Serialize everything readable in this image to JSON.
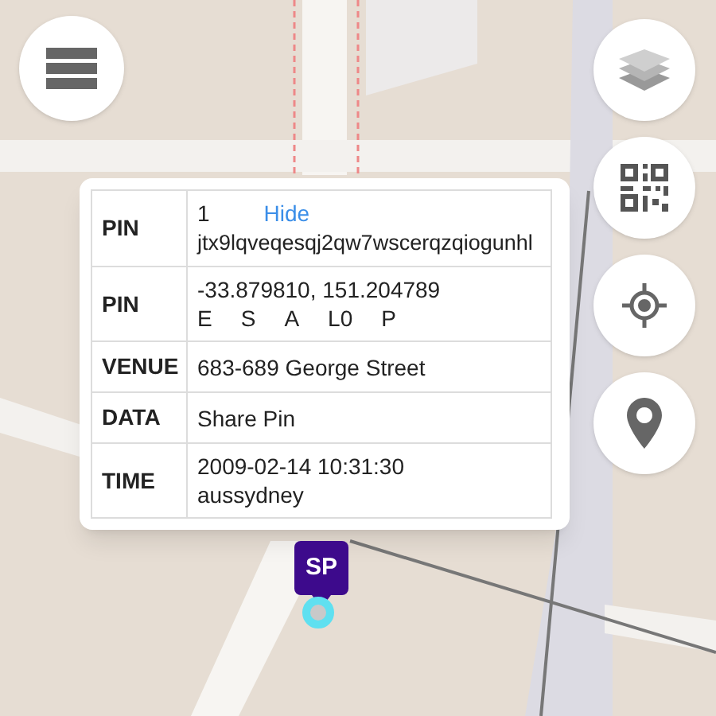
{
  "popup": {
    "rows": [
      {
        "kind": "pin_code",
        "label": "PIN",
        "number": "1",
        "link": "Hide",
        "code": "jtx9lqveqesqj2qw7wscerqzqiogunhl"
      },
      {
        "kind": "coords",
        "label": "PIN",
        "coords": "-33.879810, 151.204789",
        "flags": [
          "E",
          "S",
          "A",
          "L0",
          "P"
        ]
      },
      {
        "kind": "text",
        "label": "VENUE",
        "lines": [
          "683-689 George Street"
        ]
      },
      {
        "kind": "text",
        "label": "DATA",
        "lines": [
          "Share Pin"
        ]
      },
      {
        "kind": "text",
        "label": "TIME",
        "lines": [
          "2009-02-14 10:31:30",
          "aussydney"
        ]
      }
    ]
  },
  "marker": {
    "label": "SP"
  }
}
